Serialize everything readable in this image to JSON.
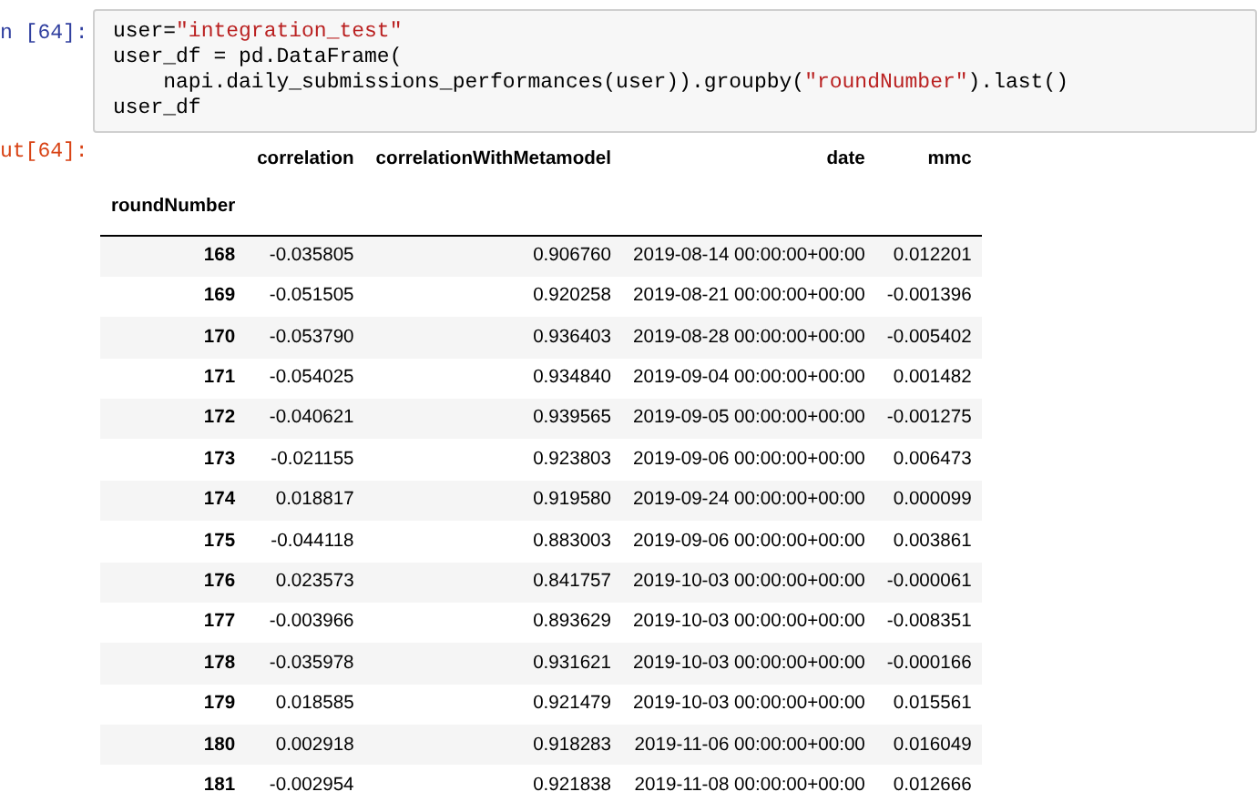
{
  "input_cell": {
    "prompt": "n [64]:",
    "lines": [
      [
        {
          "kind": "code",
          "text": "user="
        },
        {
          "kind": "string",
          "text": "\"integration_test\""
        }
      ],
      [
        {
          "kind": "code",
          "text": "user_df = pd.DataFrame("
        }
      ],
      [
        {
          "kind": "code",
          "text": "    napi.daily_submissions_performances(user)).groupby("
        },
        {
          "kind": "string",
          "text": "\"roundNumber\""
        },
        {
          "kind": "code",
          "text": ").last()"
        }
      ],
      [
        {
          "kind": "code",
          "text": "user_df"
        }
      ]
    ]
  },
  "output_cell": {
    "prompt": "ut[64]:",
    "table": {
      "header_rows": [
        [
          "",
          "correlation",
          "correlationWithMetamodel",
          "date",
          "mmc"
        ],
        [
          "roundNumber",
          "",
          "",
          "",
          ""
        ]
      ],
      "rows": [
        [
          "168",
          "-0.035805",
          "0.906760",
          "2019-08-14 00:00:00+00:00",
          "0.012201"
        ],
        [
          "169",
          "-0.051505",
          "0.920258",
          "2019-08-21 00:00:00+00:00",
          "-0.001396"
        ],
        [
          "170",
          "-0.053790",
          "0.936403",
          "2019-08-28 00:00:00+00:00",
          "-0.005402"
        ],
        [
          "171",
          "-0.054025",
          "0.934840",
          "2019-09-04 00:00:00+00:00",
          "0.001482"
        ],
        [
          "172",
          "-0.040621",
          "0.939565",
          "2019-09-05 00:00:00+00:00",
          "-0.001275"
        ],
        [
          "173",
          "-0.021155",
          "0.923803",
          "2019-09-06 00:00:00+00:00",
          "0.006473"
        ],
        [
          "174",
          "0.018817",
          "0.919580",
          "2019-09-24 00:00:00+00:00",
          "0.000099"
        ],
        [
          "175",
          "-0.044118",
          "0.883003",
          "2019-09-06 00:00:00+00:00",
          "0.003861"
        ],
        [
          "176",
          "0.023573",
          "0.841757",
          "2019-10-03 00:00:00+00:00",
          "-0.000061"
        ],
        [
          "177",
          "-0.003966",
          "0.893629",
          "2019-10-03 00:00:00+00:00",
          "-0.008351"
        ],
        [
          "178",
          "-0.035978",
          "0.931621",
          "2019-10-03 00:00:00+00:00",
          "-0.000166"
        ],
        [
          "179",
          "0.018585",
          "0.921479",
          "2019-10-03 00:00:00+00:00",
          "0.015561"
        ],
        [
          "180",
          "0.002918",
          "0.918283",
          "2019-11-06 00:00:00+00:00",
          "0.016049"
        ],
        [
          "181",
          "-0.002954",
          "0.921838",
          "2019-11-08 00:00:00+00:00",
          "0.012666"
        ]
      ]
    }
  }
}
